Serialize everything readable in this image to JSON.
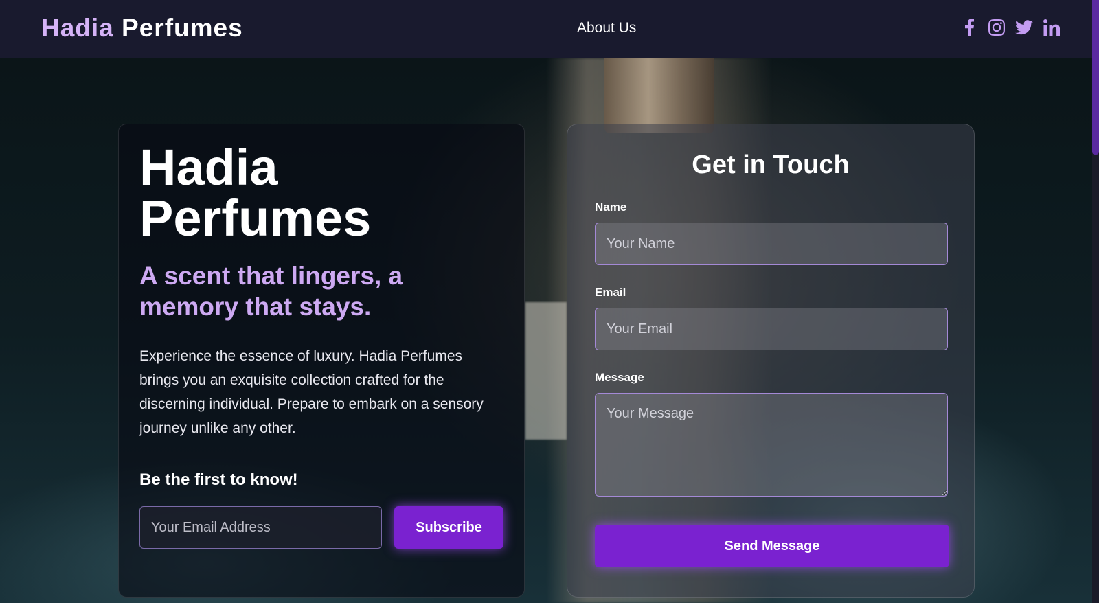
{
  "brand": {
    "first": "Hadia",
    "second": "Perfumes"
  },
  "nav": {
    "about": "About Us"
  },
  "socials": [
    {
      "icon": "facebook-icon"
    },
    {
      "icon": "instagram-icon"
    },
    {
      "icon": "twitter-icon"
    },
    {
      "icon": "linkedin-icon"
    }
  ],
  "hero": {
    "title": "Hadia Perfumes",
    "tagline": "A scent that lingers, a memory that stays.",
    "description": "Experience the essence of luxury. Hadia Perfumes brings you an exquisite collection crafted for the discerning individual. Prepare to embark on a sensory journey unlike any other.",
    "cta_heading": "Be the first to know!",
    "email_placeholder": "Your Email Address",
    "subscribe_label": "Subscribe"
  },
  "contact": {
    "title": "Get in Touch",
    "name_label": "Name",
    "name_placeholder": "Your Name",
    "email_label": "Email",
    "email_placeholder": "Your Email",
    "message_label": "Message",
    "message_placeholder": "Your Message",
    "send_label": "Send Message"
  },
  "colors": {
    "accent": "#7a22d0",
    "brand_light": "#d5b3f7",
    "tagline": "#cda9f2",
    "icon": "#c39cf2",
    "header_bg": "#191a2e"
  }
}
